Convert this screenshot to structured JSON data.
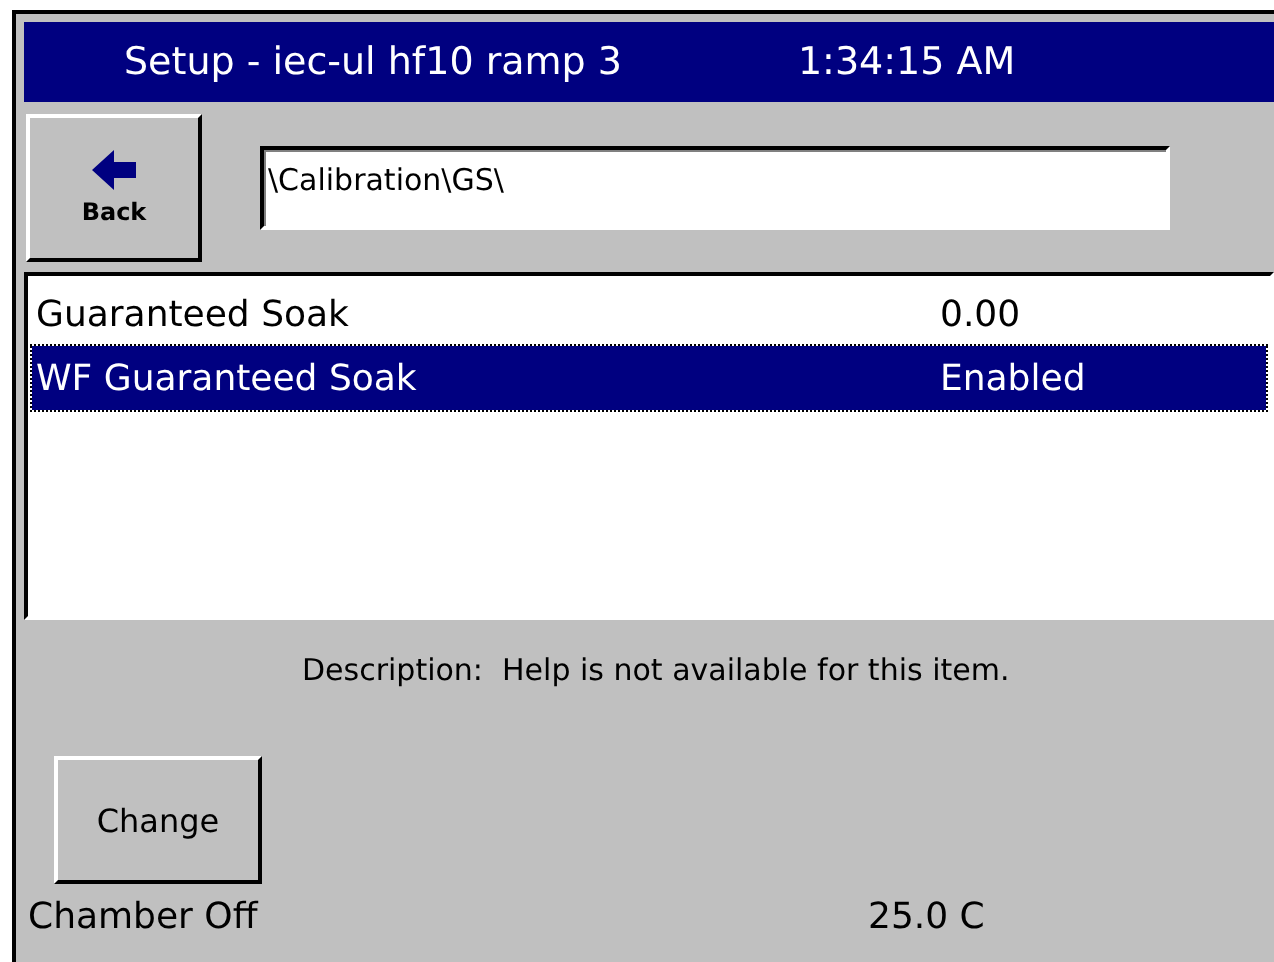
{
  "window": {
    "title": "Setup - iec-ul hf10 ramp 3",
    "time": "1:34:15 AM"
  },
  "toolbar": {
    "back_label": "Back",
    "path": "\\Calibration\\GS\\"
  },
  "list": [
    {
      "name": "Guaranteed Soak",
      "value": "0.00",
      "selected": false
    },
    {
      "name": "WF Guaranteed Soak",
      "value": "Enabled",
      "selected": true
    }
  ],
  "description": {
    "label": "Description:",
    "text": "Help is not available for this item."
  },
  "buttons": [
    "Change"
  ],
  "status_bar": {
    "state": "Chamber Off",
    "temperature": "25.0 C"
  }
}
